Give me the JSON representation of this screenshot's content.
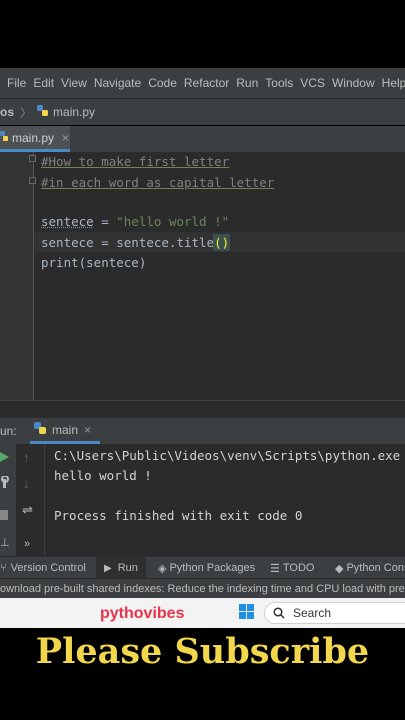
{
  "menu": {
    "items": [
      "File",
      "Edit",
      "View",
      "Navigate",
      "Code",
      "Refactor",
      "Run",
      "Tools",
      "VCS",
      "Window",
      "Help"
    ]
  },
  "breadcrumb": {
    "project": "os",
    "file": "main.py"
  },
  "editor_tab": {
    "label": "main.py",
    "close": "×"
  },
  "code": {
    "line1": "#How to make first letter",
    "line2": "#in each word as capital letter",
    "line4_var": "sentece",
    "line4_op": " = ",
    "line4_str": "\"hello world !\"",
    "line5_pre": "sentece = sentece.title",
    "line5_parens": "()",
    "line6": "print(sentece)"
  },
  "run_panel": {
    "label": "un:",
    "tab": "main",
    "command": "C:\\Users\\Public\\Videos\\venv\\Scripts\\python.exe C",
    "output": "hello world !",
    "exit": "Process finished with exit code 0"
  },
  "bottom_tabs": {
    "version_control": "Version Control",
    "run": "Run",
    "python_packages": "Python Packages",
    "todo": "TODO",
    "python_console": "Python Cons"
  },
  "status_bar": {
    "text": "ownload pre-built shared indexes: Reduce the indexing time and CPU load with pre-b"
  },
  "taskbar": {
    "search_placeholder": "Search",
    "watermark": "pythovibes"
  },
  "caption": "Please Subscribe",
  "colors": {
    "accent": "#4a88c7",
    "caption": "#f2d64b",
    "watermark": "#e8334a"
  }
}
